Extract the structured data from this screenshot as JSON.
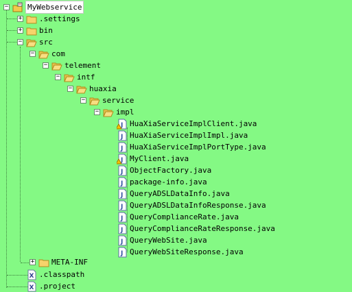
{
  "tree": {
    "root": {
      "label": "MyWebservice"
    },
    "items": [
      {
        "label": ".settings"
      },
      {
        "label": "bin"
      },
      {
        "label": "src"
      },
      {
        "label": "com"
      },
      {
        "label": "telement"
      },
      {
        "label": "intf"
      },
      {
        "label": "huaxia"
      },
      {
        "label": "service"
      },
      {
        "label": "impl"
      },
      {
        "label": "HuaXiaServiceImplClient.java"
      },
      {
        "label": "HuaXiaServiceImplImpl.java"
      },
      {
        "label": "HuaXiaServiceImplPortType.java"
      },
      {
        "label": "MyClient.java"
      },
      {
        "label": "ObjectFactory.java"
      },
      {
        "label": "package-info.java"
      },
      {
        "label": "QueryADSLDataInfo.java"
      },
      {
        "label": "QueryADSLDataInfoResponse.java"
      },
      {
        "label": "QueryComplianceRate.java"
      },
      {
        "label": "QueryComplianceRateResponse.java"
      },
      {
        "label": "QueryWebSite.java"
      },
      {
        "label": "QueryWebSiteResponse.java"
      },
      {
        "label": "META-INF"
      },
      {
        "label": ".classpath"
      },
      {
        "label": ".project"
      }
    ],
    "toggle_expanded": "−",
    "toggle_collapsed": "+"
  }
}
